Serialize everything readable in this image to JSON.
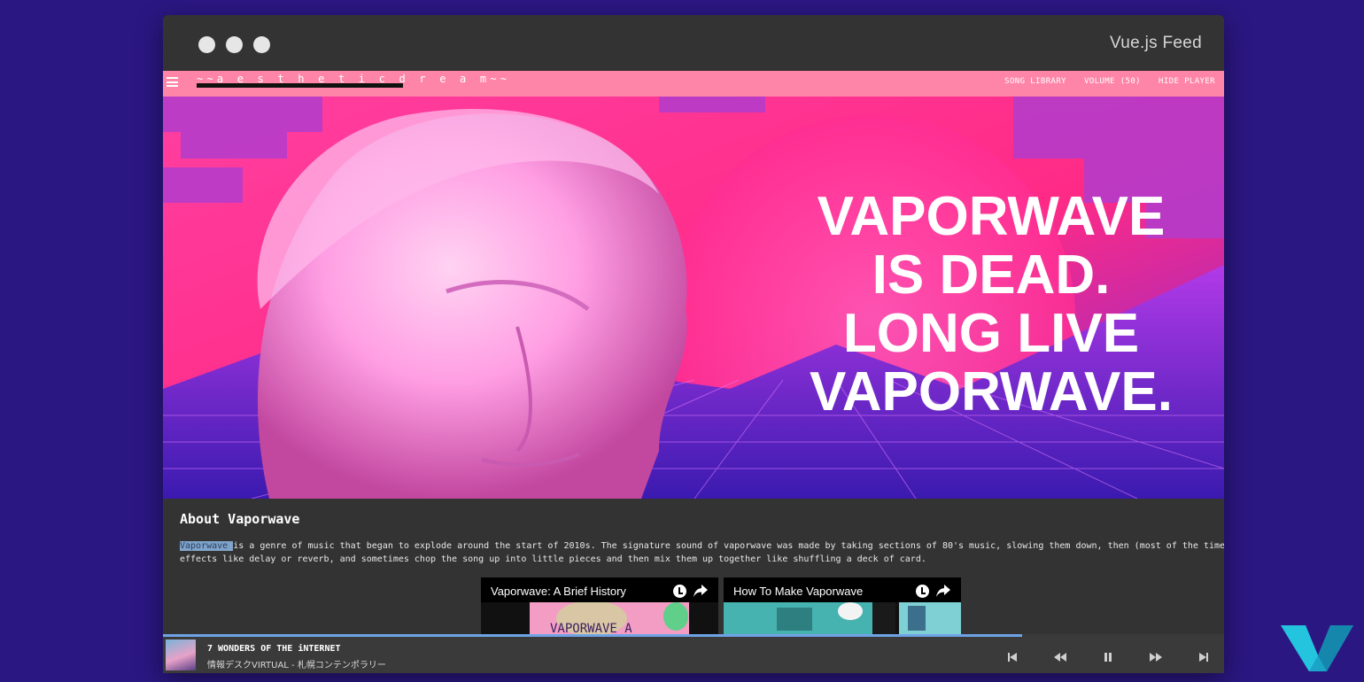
{
  "window": {
    "title": "Vue.js Feed"
  },
  "appbar": {
    "brand": "~~a e s t h e t i c   d r e a m~~",
    "nav": [
      "SONG LIBRARY",
      "VOLUME (50)",
      "HIDE PLAYER"
    ]
  },
  "hero": {
    "headline_lines": [
      "VAPORWAVE",
      "IS DEAD.",
      "LONG LIVE",
      "VAPORWAVE."
    ]
  },
  "about": {
    "title": "About Vaporwave",
    "highlight": "Vaporwave ",
    "line1_rest": "is a genre of music that began to explode around the start of 2010s. The signature sound of vaporwave was made by taking sections of 80's music, slowing them down, then (most of the time) add a lot of",
    "line2": "effects like delay or reverb, and sometimes chop the song up into little pieces and then mix them up together like shuffling a deck of card."
  },
  "videos": [
    {
      "title": "Vaporwave: A Brief History"
    },
    {
      "title": "How To Make Vaporwave"
    }
  ],
  "player": {
    "track_title": "7 WONDERS OF THE iNTERNET",
    "track_artist": "情報デスクVIRTUAL - 札幌コンテンポラリー",
    "progress": 0.81
  },
  "colors": {
    "background": "#2b1782",
    "appbar": "#ff85a8",
    "window": "#333333",
    "progress": "#6fa3e6"
  },
  "icons": [
    "menu-icon",
    "clock-icon",
    "share-icon",
    "skip-previous-icon",
    "rewind-icon",
    "pause-icon",
    "fast-forward-icon",
    "skip-next-icon"
  ]
}
